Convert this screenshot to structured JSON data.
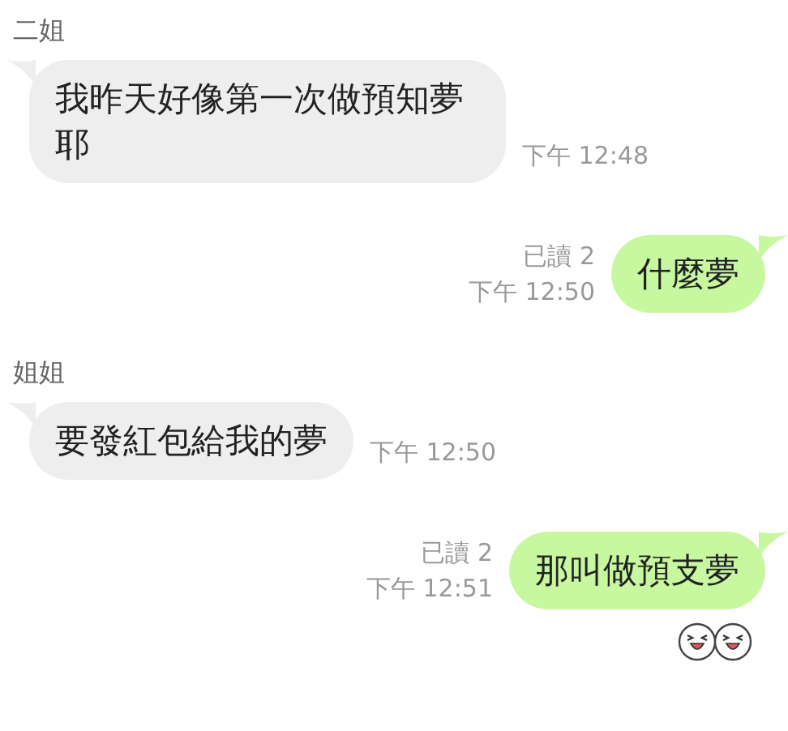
{
  "messages": [
    {
      "kind": "incoming",
      "sender": "二姐",
      "text": "我昨天好像第一次做預知夢耶",
      "time": "下午 12:48"
    },
    {
      "kind": "outgoing",
      "text": "什麼夢",
      "read": "已讀 2",
      "time": "下午 12:50"
    },
    {
      "kind": "incoming",
      "sender": "姐姐",
      "text": "要發紅包給我的夢",
      "time": "下午 12:50"
    },
    {
      "kind": "outgoing",
      "text": "那叫做預支夢",
      "read": "已讀 2",
      "time": "下午 12:51",
      "reactions": [
        {
          "kind": "laughing"
        },
        {
          "kind": "laughing"
        }
      ]
    }
  ]
}
